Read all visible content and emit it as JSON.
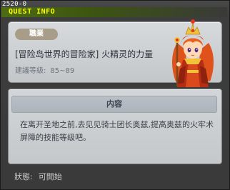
{
  "window": {
    "quest_id": "2520-0",
    "title": "QUEST INFO"
  },
  "quest": {
    "category": "職業",
    "title": "[冒险岛世界的冒险家] 火精灵的力量",
    "level_label": "建議等級:",
    "level_range": "85~89"
  },
  "content": {
    "header": "内容",
    "description": "在离开圣地之前,去见见骑士团长奥兹,提高奥兹的火牢术屏障的技能等级吧。"
  },
  "status": {
    "label": "狀態:",
    "value": "可開始"
  },
  "npc": {
    "icon": "fire-spirit-oz-portrait"
  },
  "colors": {
    "title_text": "#ffff00",
    "title_bar": "#4d6c12",
    "panel": "#d7dadc",
    "tag": "#a89d88"
  }
}
